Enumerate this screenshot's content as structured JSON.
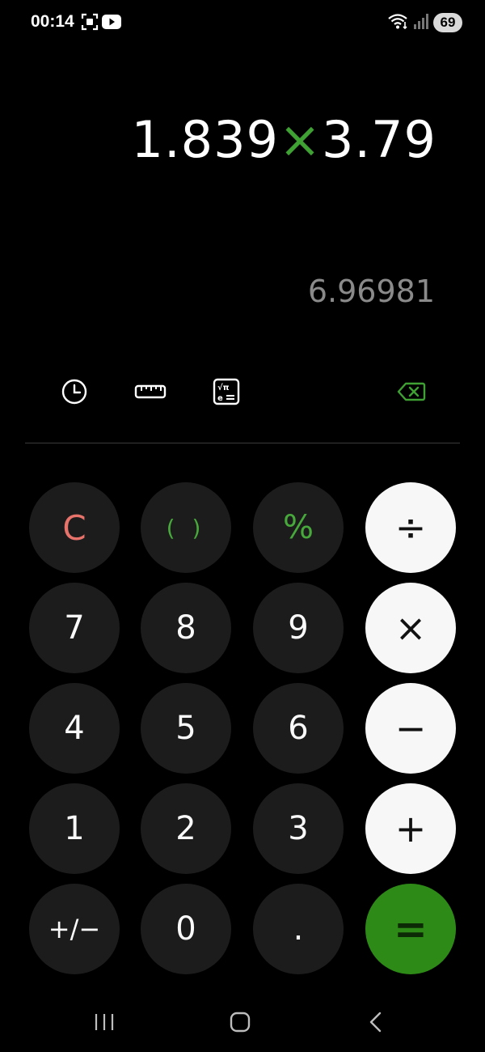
{
  "status_bar": {
    "time": "00:14",
    "battery": "69"
  },
  "display": {
    "operand_a": "1.839",
    "operator": "×",
    "operand_b": "3.79",
    "result": "6.96981"
  },
  "keypad": {
    "row1": [
      "C",
      "( )",
      "%",
      "÷"
    ],
    "row2": [
      "7",
      "8",
      "9",
      "×"
    ],
    "row3": [
      "4",
      "5",
      "6",
      "−"
    ],
    "row4": [
      "1",
      "2",
      "3",
      "+"
    ],
    "row5": [
      "+/−",
      "0",
      ".",
      "="
    ]
  },
  "colors": {
    "accent_green": "#2e8a17",
    "operator_green": "#3fa033",
    "clear_red": "#e8736b",
    "key_dark": "#1c1c1c",
    "operator_key": "#f7f7f7"
  },
  "icons": {
    "history": "clock-icon",
    "unit_converter": "ruler-icon",
    "scientific": "scientific-mode-icon",
    "backspace": "backspace-icon"
  }
}
